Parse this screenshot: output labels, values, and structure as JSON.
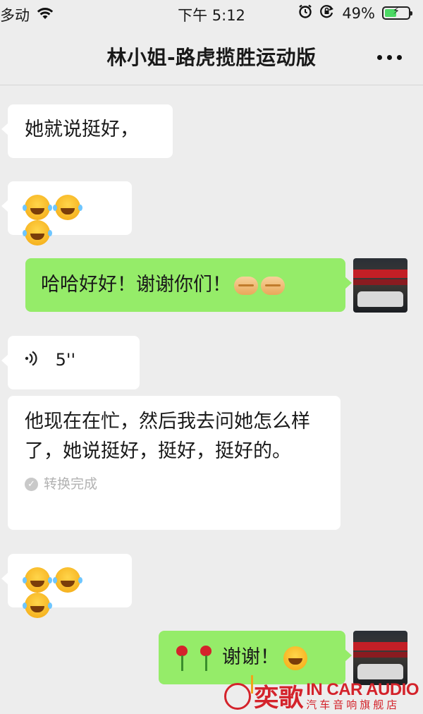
{
  "status_bar": {
    "carrier": "多动",
    "time": "下午 5:12",
    "battery_percent": "49%",
    "battery_level": 0.49,
    "icons": [
      "wifi-icon",
      "alarm-icon",
      "orientation-lock-icon",
      "battery-icon"
    ]
  },
  "nav": {
    "title": "林小姐-路虎揽胜运动版",
    "more_icon": "more-icon"
  },
  "messages": [
    {
      "side": "left",
      "type": "text",
      "text": "她就说挺好，"
    },
    {
      "side": "left",
      "type": "emoji",
      "emojis": [
        "laugh-cry-emoji",
        "laugh-cry-emoji",
        "laugh-cry-emoji"
      ]
    },
    {
      "side": "right",
      "type": "text",
      "text": "哈哈好好！谢谢你们！",
      "emojis": [
        "handshake-emoji",
        "handshake-emoji"
      ]
    },
    {
      "side": "left",
      "type": "voice",
      "duration": "5''",
      "transcript": "他现在在忙，然后我去问她怎么样了，她说挺好，挺好，挺好的。",
      "status": "转换完成"
    },
    {
      "side": "left",
      "type": "emoji",
      "emojis": [
        "laugh-cry-emoji",
        "laugh-cry-emoji",
        "laugh-cry-emoji"
      ]
    },
    {
      "side": "right",
      "type": "text",
      "text": "谢谢！",
      "emojis": [
        "rose-emoji",
        "rose-emoji",
        "grin-emoji"
      ]
    }
  ],
  "watermark": {
    "brand_cn": "奕歌",
    "brand_en": "IN CAR AUDIO",
    "subtitle": "汽车音响旗舰店",
    "brand_color": "#d4232b"
  },
  "colors": {
    "background": "#ededed",
    "bubble_self": "#95ec69",
    "bubble_other": "#ffffff"
  }
}
